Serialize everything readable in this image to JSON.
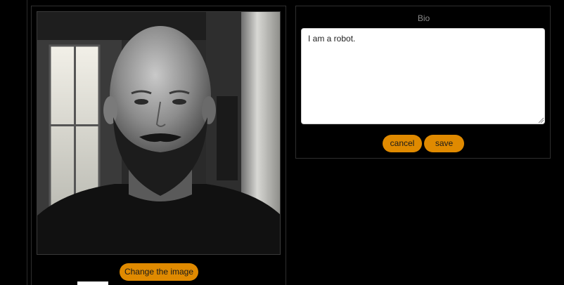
{
  "profile": {
    "change_image_label": "Change the image",
    "photo_icon": "profile-photo"
  },
  "bio": {
    "title": "Bio",
    "text": "I am a robot.",
    "cancel_label": "cancel",
    "save_label": "save"
  },
  "colors": {
    "accent": "#e08a00",
    "background": "#000000",
    "panel_border": "#2e2e2e",
    "muted_text": "#8a8a8a"
  }
}
